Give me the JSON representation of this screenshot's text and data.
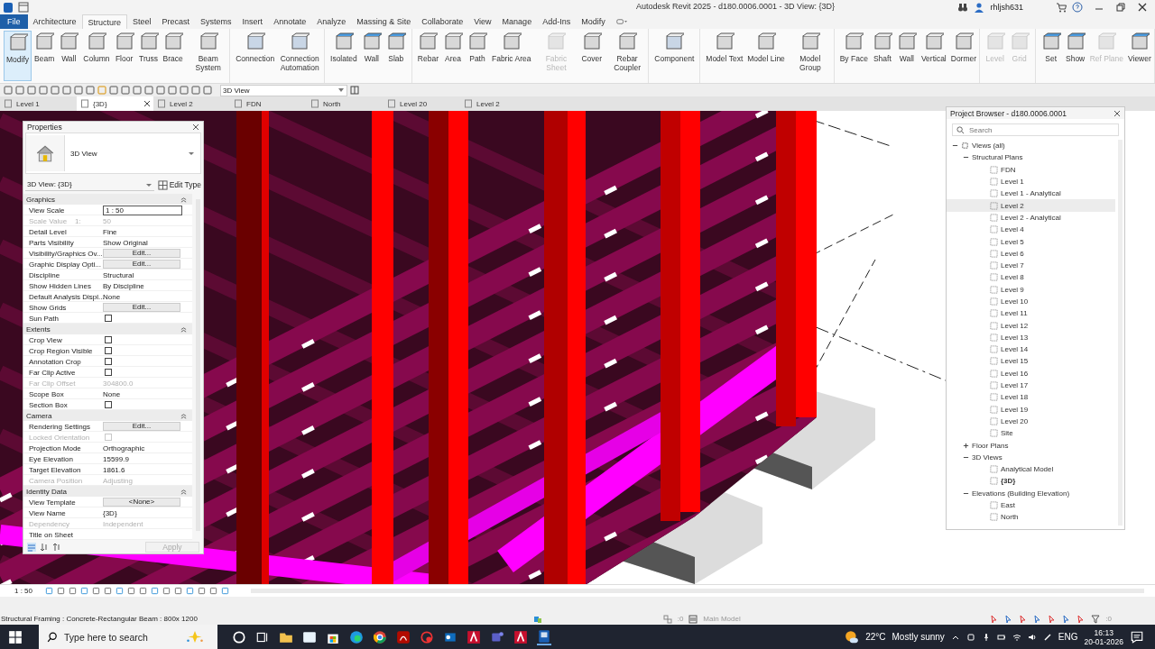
{
  "window": {
    "title": "Autodesk Revit 2025 - d180.0006.0001 - 3D View: {3D}",
    "user": "rhljsh631"
  },
  "menu_tabs": [
    {
      "label": "File",
      "kind": "file",
      "selected": false
    },
    {
      "label": "Architecture",
      "kind": "tab",
      "selected": false
    },
    {
      "label": "Structure",
      "kind": "tab",
      "selected": true
    },
    {
      "label": "Steel",
      "kind": "tab",
      "selected": false
    },
    {
      "label": "Precast",
      "kind": "tab",
      "selected": false
    },
    {
      "label": "Systems",
      "kind": "tab",
      "selected": false
    },
    {
      "label": "Insert",
      "kind": "tab",
      "selected": false
    },
    {
      "label": "Annotate",
      "kind": "tab",
      "selected": false
    },
    {
      "label": "Analyze",
      "kind": "tab",
      "selected": false
    },
    {
      "label": "Massing & Site",
      "kind": "tab",
      "selected": false
    },
    {
      "label": "Collaborate",
      "kind": "tab",
      "selected": false
    },
    {
      "label": "View",
      "kind": "tab",
      "selected": false
    },
    {
      "label": "Manage",
      "kind": "tab",
      "selected": false
    },
    {
      "label": "Add-Ins",
      "kind": "tab",
      "selected": false
    },
    {
      "label": "Modify",
      "kind": "tab",
      "selected": false
    }
  ],
  "ribbon": [
    {
      "tools": [
        {
          "label": "Modify",
          "selected": true,
          "disabled": false
        },
        {
          "label": "Beam",
          "selected": false,
          "disabled": false
        },
        {
          "label": "Wall",
          "selected": false,
          "disabled": false
        },
        {
          "label": "Column",
          "selected": false,
          "disabled": false
        },
        {
          "label": "Floor",
          "selected": false,
          "disabled": false
        },
        {
          "label": "Truss",
          "selected": false,
          "disabled": false
        },
        {
          "label": "Brace",
          "selected": false,
          "disabled": false
        },
        {
          "label": "Beam System",
          "selected": false,
          "disabled": false
        }
      ]
    },
    {
      "tools": [
        {
          "label": "Connection",
          "selected": false,
          "disabled": false
        },
        {
          "label": "Connection Automation",
          "selected": false,
          "disabled": false
        }
      ]
    },
    {
      "tools": [
        {
          "label": "Isolated",
          "selected": false,
          "disabled": false
        },
        {
          "label": "Wall",
          "selected": false,
          "disabled": false
        },
        {
          "label": "Slab",
          "selected": false,
          "disabled": false
        }
      ]
    },
    {
      "tools": [
        {
          "label": "Rebar",
          "selected": false,
          "disabled": false
        },
        {
          "label": "Area",
          "selected": false,
          "disabled": false
        },
        {
          "label": "Path",
          "selected": false,
          "disabled": false
        },
        {
          "label": "Fabric Area",
          "selected": false,
          "disabled": false
        },
        {
          "label": "Fabric Sheet",
          "selected": false,
          "disabled": true
        },
        {
          "label": "Cover",
          "selected": false,
          "disabled": false
        },
        {
          "label": "Rebar Coupler",
          "selected": false,
          "disabled": false
        }
      ]
    },
    {
      "tools": [
        {
          "label": "Component",
          "selected": false,
          "disabled": false
        }
      ]
    },
    {
      "tools": [
        {
          "label": "Model Text",
          "selected": false,
          "disabled": false
        },
        {
          "label": "Model Line",
          "selected": false,
          "disabled": false
        },
        {
          "label": "Model Group",
          "selected": false,
          "disabled": false
        }
      ]
    },
    {
      "tools": [
        {
          "label": "By Face",
          "selected": false,
          "disabled": false
        },
        {
          "label": "Shaft",
          "selected": false,
          "disabled": false
        },
        {
          "label": "Wall",
          "selected": false,
          "disabled": false
        },
        {
          "label": "Vertical",
          "selected": false,
          "disabled": false
        },
        {
          "label": "Dormer",
          "selected": false,
          "disabled": false
        }
      ]
    },
    {
      "tools": [
        {
          "label": "Level",
          "selected": false,
          "disabled": true
        },
        {
          "label": "Grid",
          "selected": false,
          "disabled": true
        }
      ]
    },
    {
      "tools": [
        {
          "label": "Set",
          "selected": false,
          "disabled": false
        },
        {
          "label": "Show",
          "selected": false,
          "disabled": false
        },
        {
          "label": "Ref Plane",
          "selected": false,
          "disabled": true
        },
        {
          "label": "Viewer",
          "selected": false,
          "disabled": false
        }
      ]
    }
  ],
  "quick_access": {
    "view_selector": "3D View"
  },
  "view_tabs": [
    {
      "label": "Level 1",
      "selected": false
    },
    {
      "label": "{3D}",
      "selected": true
    },
    {
      "label": "Level 2",
      "selected": false
    },
    {
      "label": "FDN",
      "selected": false
    },
    {
      "label": "North",
      "selected": false
    },
    {
      "label": "Level 20",
      "selected": false
    },
    {
      "label": "Level 2",
      "selected": false
    }
  ],
  "properties": {
    "title": "Properties",
    "type_name": "3D View",
    "instance": "3D View: {3D}",
    "edit_type": "Edit Type",
    "apply": "Apply",
    "sections": [
      {
        "name": "Graphics",
        "rows": [
          {
            "label": "View Scale",
            "value": "1 : 50",
            "kind": "field",
            "disabled": false
          },
          {
            "label": "Scale Value    1:",
            "value": "50",
            "kind": "text",
            "disabled": true
          },
          {
            "label": "Detail Level",
            "value": "Fine",
            "kind": "text",
            "disabled": false
          },
          {
            "label": "Parts Visibility",
            "value": "Show Original",
            "kind": "text",
            "disabled": false
          },
          {
            "label": "Visibility/Graphics Ov...",
            "value": "Edit...",
            "kind": "button",
            "disabled": false
          },
          {
            "label": "Graphic Display Opti...",
            "value": "Edit...",
            "kind": "button",
            "disabled": false
          },
          {
            "label": "Discipline",
            "value": "Structural",
            "kind": "text",
            "disabled": false
          },
          {
            "label": "Show Hidden Lines",
            "value": "By Discipline",
            "kind": "text",
            "disabled": false
          },
          {
            "label": "Default Analysis Displ...",
            "value": "None",
            "kind": "text",
            "disabled": false
          },
          {
            "label": "Show Grids",
            "value": "Edit...",
            "kind": "button",
            "disabled": false
          },
          {
            "label": "Sun Path",
            "kind": "checkbox",
            "checked": false,
            "disabled": false
          }
        ]
      },
      {
        "name": "Extents",
        "rows": [
          {
            "label": "Crop View",
            "kind": "checkbox",
            "checked": false,
            "disabled": false
          },
          {
            "label": "Crop Region Visible",
            "kind": "checkbox",
            "checked": false,
            "disabled": false
          },
          {
            "label": "Annotation Crop",
            "kind": "checkbox",
            "checked": false,
            "disabled": false
          },
          {
            "label": "Far Clip Active",
            "kind": "checkbox",
            "checked": false,
            "disabled": false
          },
          {
            "label": "Far Clip Offset",
            "value": "304800.0",
            "kind": "text",
            "disabled": true
          },
          {
            "label": "Scope Box",
            "value": "None",
            "kind": "text",
            "disabled": false
          },
          {
            "label": "Section Box",
            "kind": "checkbox",
            "checked": false,
            "disabled": false
          }
        ]
      },
      {
        "name": "Camera",
        "rows": [
          {
            "label": "Rendering Settings",
            "value": "Edit...",
            "kind": "button",
            "disabled": false
          },
          {
            "label": "Locked Orientation",
            "kind": "checkbox",
            "checked": false,
            "disabled": true
          },
          {
            "label": "Projection Mode",
            "value": "Orthographic",
            "kind": "text",
            "disabled": false
          },
          {
            "label": "Eye Elevation",
            "value": "15599.9",
            "kind": "text",
            "disabled": false
          },
          {
            "label": "Target Elevation",
            "value": "1861.6",
            "kind": "text",
            "disabled": false
          },
          {
            "label": "Camera Position",
            "value": "Adjusting",
            "kind": "text",
            "disabled": true
          }
        ]
      },
      {
        "name": "Identity Data",
        "rows": [
          {
            "label": "View Template",
            "value": "<None>",
            "kind": "button",
            "disabled": false
          },
          {
            "label": "View Name",
            "value": "{3D}",
            "kind": "text",
            "disabled": false
          },
          {
            "label": "Dependency",
            "value": "Independent",
            "kind": "text",
            "disabled": true
          },
          {
            "label": "Title on Sheet",
            "kind": "text",
            "disabled": false
          }
        ]
      }
    ]
  },
  "project_browser": {
    "title": "Project Browser - d180.0006.0001",
    "search_placeholder": "Search",
    "tree": [
      {
        "label": "Views (all)",
        "expanded": true,
        "children": [
          {
            "label": "Structural Plans",
            "expanded": true,
            "children": [
              {
                "label": "FDN",
                "selected": false,
                "open": false
              },
              {
                "label": "Level 1",
                "selected": false,
                "open": false
              },
              {
                "label": "Level 1 - Analytical",
                "selected": false,
                "open": false
              },
              {
                "label": "Level 2",
                "selected": true,
                "open": false
              },
              {
                "label": "Level 2 - Analytical",
                "selected": false,
                "open": false
              },
              {
                "label": "Level 4",
                "selected": false,
                "open": false
              },
              {
                "label": "Level 5",
                "selected": false,
                "open": false
              },
              {
                "label": "Level 6",
                "selected": false,
                "open": false
              },
              {
                "label": "Level 7",
                "selected": false,
                "open": false
              },
              {
                "label": "Level 8",
                "selected": false,
                "open": false
              },
              {
                "label": "Level 9",
                "selected": false,
                "open": false
              },
              {
                "label": "Level 10",
                "selected": false,
                "open": false
              },
              {
                "label": "Level 11",
                "selected": false,
                "open": false
              },
              {
                "label": "Level 12",
                "selected": false,
                "open": false
              },
              {
                "label": "Level 13",
                "selected": false,
                "open": false
              },
              {
                "label": "Level 14",
                "selected": false,
                "open": false
              },
              {
                "label": "Level 15",
                "selected": false,
                "open": false
              },
              {
                "label": "Level 16",
                "selected": false,
                "open": false
              },
              {
                "label": "Level 17",
                "selected": false,
                "open": false
              },
              {
                "label": "Level 18",
                "selected": false,
                "open": false
              },
              {
                "label": "Level 19",
                "selected": false,
                "open": false
              },
              {
                "label": "Level 20",
                "selected": false,
                "open": false
              },
              {
                "label": "Site",
                "selected": false,
                "open": false
              }
            ]
          },
          {
            "label": "Floor Plans",
            "expanded": false
          },
          {
            "label": "3D Views",
            "expanded": true,
            "children": [
              {
                "label": "Analytical Model",
                "selected": false,
                "open": false
              },
              {
                "label": "{3D}",
                "selected": false,
                "open": true
              }
            ]
          },
          {
            "label": "Elevations (Building Elevation)",
            "expanded": true,
            "children": [
              {
                "label": "East",
                "selected": false,
                "open": false
              },
              {
                "label": "North",
                "selected": false,
                "open": false
              }
            ]
          }
        ]
      }
    ]
  },
  "view_bar": {
    "scale": "1 : 50"
  },
  "status_bar": {
    "message": "Structural Framing : Concrete-Rectangular Beam : 800x 1200",
    "worksharing_count": ":0",
    "model": "Main Model",
    "filter_count": ":0"
  },
  "taskbar": {
    "search_placeholder": "Type here to search",
    "temperature": "22°C",
    "weather": "Mostly sunny",
    "language": "ENG",
    "time": "16:13",
    "date": "20-01-2026"
  }
}
